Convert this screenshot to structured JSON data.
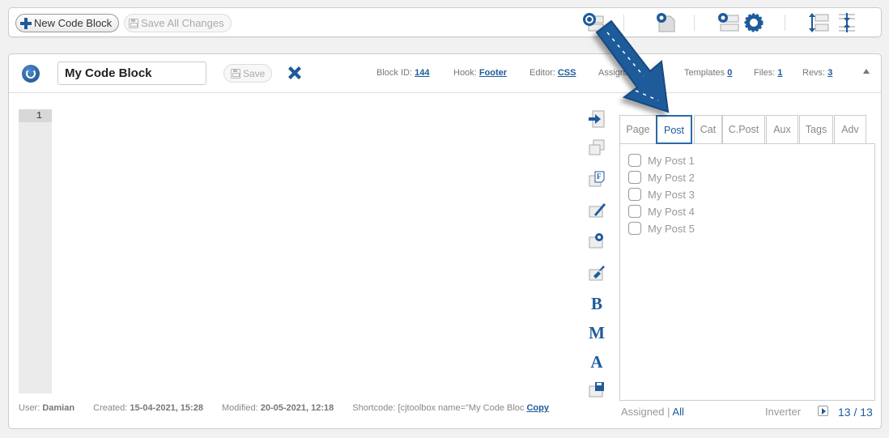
{
  "toolbar": {
    "new_block_label": "New Code Block",
    "save_all_label": "Save All Changes"
  },
  "block": {
    "title_value": "My Code Block",
    "save_label": "Save",
    "meta": {
      "block_id_label": "Block ID:",
      "block_id": "144",
      "hook_label": "Hook:",
      "hook": "Footer",
      "editor_label": "Editor:",
      "editor": "CSS",
      "assignments_label": "Assignments:",
      "templates_label": "Templates",
      "templates": "0",
      "files_label": "Files:",
      "files": "1",
      "revs_label": "Revs:",
      "revs": "3"
    },
    "line_numbers": [
      "1"
    ],
    "side_tools": [
      "insert-icon",
      "duplicate-icon",
      "format-icon",
      "edit-icon",
      "settings-icon",
      "beautify-icon",
      "bold-icon",
      "minify-icon",
      "font-size-icon",
      "save-file-icon"
    ],
    "letters": {
      "bold": "B",
      "minify": "M",
      "font": "A"
    }
  },
  "assign": {
    "tabs": [
      "Page",
      "Post",
      "Cat",
      "C.Post",
      "Aux",
      "Tags",
      "Adv"
    ],
    "active_tab": "Post",
    "posts": [
      "My Post 1",
      "My Post 2",
      "My Post 3",
      "My Post 4",
      "My Post 5"
    ],
    "filter_assigned": "Assigned",
    "filter_sep": "|",
    "filter_all": "All",
    "inverter_label": "Inverter",
    "page_count": "13 / 13"
  },
  "footer": {
    "user_label": "User:",
    "user": "Damian",
    "created_label": "Created:",
    "created": "15-04-2021, 15:28",
    "modified_label": "Modified:",
    "modified": "20-05-2021, 12:18",
    "shortcode_label": "Shortcode:",
    "shortcode": "[cjtoolbox name=\"My Code Bloc",
    "copy_label": "Copy"
  },
  "colors": {
    "accent": "#1d5b9b"
  }
}
